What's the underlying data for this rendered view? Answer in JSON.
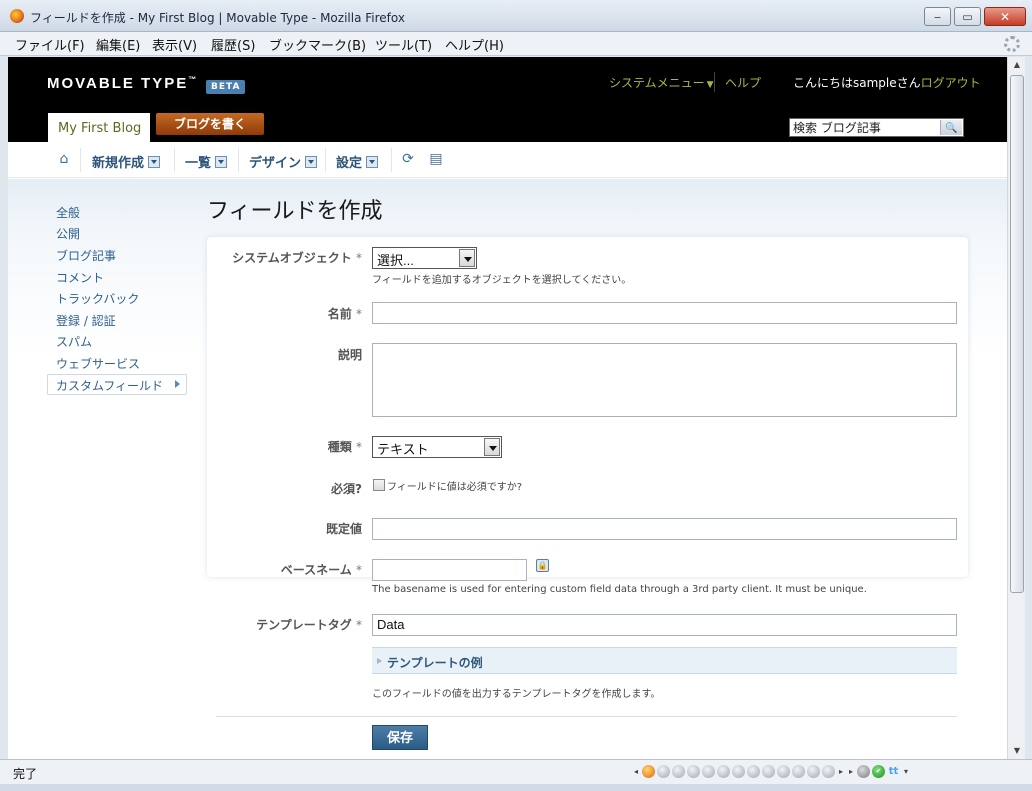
{
  "window": {
    "title": "フィールドを作成 - My First Blog | Movable Type - Mozilla Firefox",
    "minimize": "‒",
    "maximize": "▭",
    "close": "✕"
  },
  "menubar": [
    "ファイル(F)",
    "編集(E)",
    "表示(V)",
    "履歴(S)",
    "ブックマーク(B)",
    "ツール(T)",
    "ヘルプ(H)"
  ],
  "header": {
    "logo": "MOVABLE TYPE",
    "logo_tm": "™",
    "beta": "BETA",
    "system_menu": "システムメニュー",
    "system_menu_caret": "▼",
    "help": "ヘルプ",
    "greeting": "こんにちはsampleさん",
    "logout": "ログアウト",
    "blog_tab": "My First Blog",
    "write_entry": "ブログを書く",
    "search_value": "検索 ブログ記事",
    "search_icon_glyph": "🔍"
  },
  "nav": {
    "home_glyph": "⌂",
    "items": [
      "新規作成",
      "一覧",
      "デザイン",
      "設定"
    ],
    "refresh_glyph": "⟳",
    "view_glyph": "▤"
  },
  "sidebar": {
    "items": [
      "全般",
      "公開",
      "ブログ記事",
      "コメント",
      "トラックバック",
      "登録 / 認証",
      "スパム",
      "ウェブサービス",
      "カスタムフィールド"
    ],
    "active_index": 8
  },
  "page": {
    "title": "フィールドを作成"
  },
  "form": {
    "system_object": {
      "label": "システムオブジェクト",
      "required": "*",
      "value": "選択...",
      "hint": "フィールドを追加するオブジェクトを選択してください。"
    },
    "name": {
      "label": "名前",
      "required": "*",
      "value": ""
    },
    "description": {
      "label": "説明",
      "value": ""
    },
    "type": {
      "label": "種類",
      "required": "*",
      "value": "テキスト"
    },
    "required_field": {
      "label": "必須?",
      "checkbox_label": "フィールドに値は必須ですか?",
      "checked": false
    },
    "default": {
      "label": "既定値",
      "value": ""
    },
    "basename": {
      "label": "ベースネーム",
      "required": "*",
      "value": "",
      "hint": "The basename is used for entering custom field data through a 3rd party client. It must be unique.",
      "lock_glyph": "🔒"
    },
    "template_tag": {
      "label": "テンプレートタグ",
      "required": "*",
      "value": "Data",
      "example_toggle": "テンプレートの例",
      "hint": "このフィールドの値を出力するテンプレートタグを作成します。"
    },
    "save": "保存"
  },
  "statusbar": {
    "status": "完了",
    "icons": [
      "◂",
      "🔥",
      "◉",
      "◉",
      "◉",
      "◉",
      "◉",
      "◉",
      "◉",
      "◉",
      "◉",
      "◉",
      "◉",
      "◉",
      "▸",
      "▸",
      "😺",
      "✔",
      "tt",
      "▾"
    ]
  }
}
